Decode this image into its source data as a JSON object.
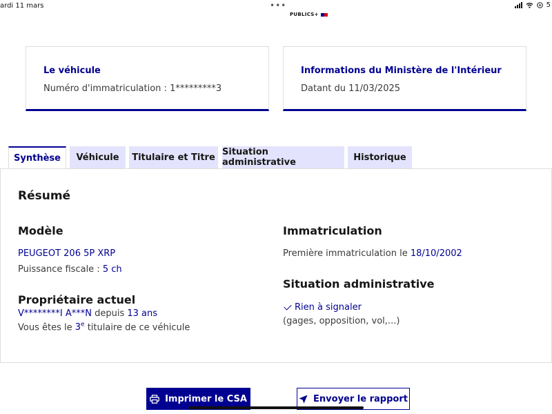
{
  "status_bar": {
    "time": "ardi 11 mars",
    "dots": "•••",
    "battery": "5"
  },
  "brand": {
    "name": "PUBLICS+"
  },
  "vehicle_card": {
    "title": "Le véhicule",
    "plate_label": "Numéro d'immatriculation : 1*********3"
  },
  "ministry_card": {
    "title": "Informations du Ministère de l'Intérieur",
    "date_label": "Datant du 11/03/2025"
  },
  "tabs": [
    {
      "label": "Synthèse",
      "active": true
    },
    {
      "label": "Véhicule",
      "active": false
    },
    {
      "label": "Titulaire et Titre",
      "active": false
    },
    {
      "label": "Situation administrative",
      "active": false
    },
    {
      "label": "Historique",
      "active": false
    }
  ],
  "summary": {
    "title": "Résumé",
    "model": {
      "heading": "Modèle",
      "name": "PEUGEOT 206 5P XRP",
      "power_label": "Puissance fiscale : ",
      "power_value": "5 ch"
    },
    "owner": {
      "heading": "Propriétaire actuel",
      "name": "V********I A***N",
      "since_label": " depuis ",
      "since_value": "13 ans",
      "rank_prefix": "Vous êtes le ",
      "rank_number": "3",
      "rank_sup": "e",
      "rank_suffix": " titulaire de ce véhicule"
    },
    "registration": {
      "heading": "Immatriculation",
      "first_label": "Première immatriculation le ",
      "first_date": "18/10/2002"
    },
    "admin": {
      "heading": "Situation administrative",
      "status": "Rien à signaler",
      "details": "(gages, opposition, vol,...)"
    }
  },
  "actions": {
    "print_label": "Imprimer le CSA",
    "send_label": "Envoyer le rapport"
  },
  "colors": {
    "primary": "#000091",
    "tab_background": "#e3e3fd",
    "border": "#dddddd"
  }
}
